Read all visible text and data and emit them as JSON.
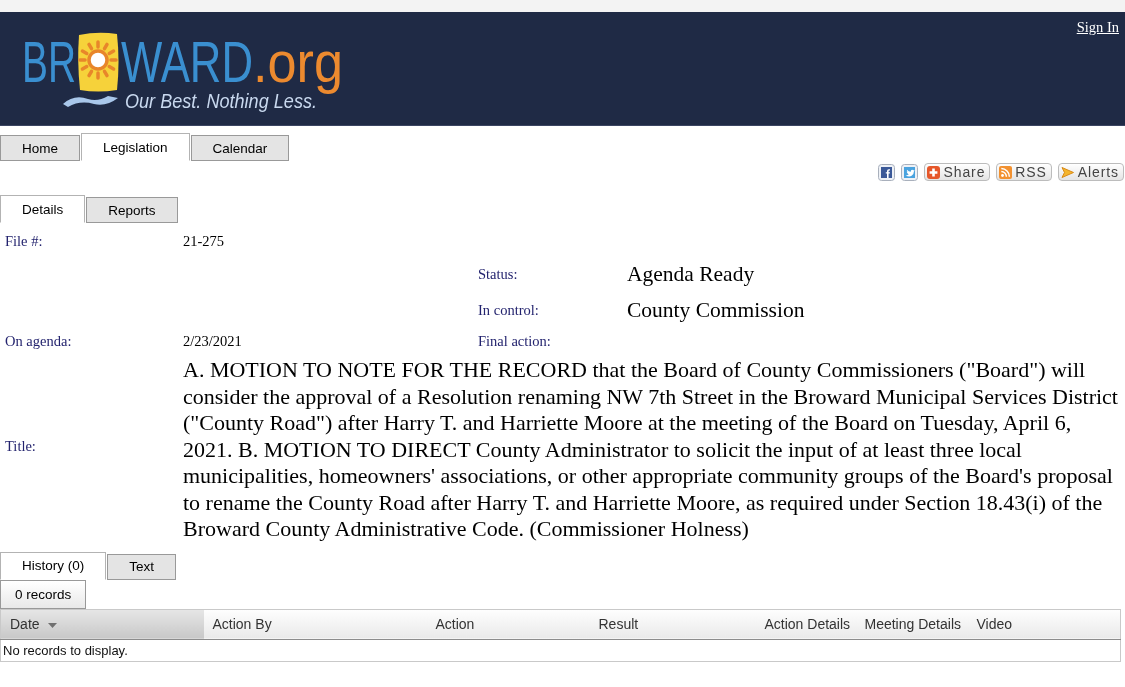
{
  "header": {
    "logo": {
      "wordmark": [
        {
          "text": "BR",
          "kind": "name"
        },
        {
          "text": "WARD",
          "kind": "name"
        },
        {
          "text": ".org",
          "kind": "domain"
        }
      ],
      "tagline": "Our Best. Nothing Less."
    },
    "sign_in": "Sign In"
  },
  "main_tabs": [
    {
      "label": "Home",
      "selected": false
    },
    {
      "label": "Legislation",
      "selected": true
    },
    {
      "label": "Calendar",
      "selected": false
    }
  ],
  "share_bar": [
    {
      "kind": "share",
      "label": "Share"
    },
    {
      "kind": "rss",
      "label": "RSS"
    },
    {
      "kind": "alerts",
      "label": "Alerts"
    }
  ],
  "detail_tabs": [
    {
      "label": "Details",
      "selected": true
    },
    {
      "label": "Reports",
      "selected": false
    }
  ],
  "details": {
    "file_number": {
      "label": "File #:",
      "value": "21-275"
    },
    "status": {
      "label": "Status:",
      "value": "Agenda Ready"
    },
    "in_control": {
      "label": "In control:",
      "value": "County Commission"
    },
    "on_agenda": {
      "label": "On agenda:",
      "value": "2/23/2021"
    },
    "final_action": {
      "label": "Final action:"
    },
    "title": {
      "label": "Title:",
      "value": "A. MOTION TO NOTE FOR THE RECORD that the Board of County Commissioners (\"Board\") will consider the approval of a Resolution renaming NW 7th Street in the Broward Municipal Services District (\"County Road\") after Harry T. and Harriette Moore at the meeting of the Board on Tuesday, April 6, 2021. B. MOTION TO DIRECT County Administrator to solicit the input of at least three local municipalities, homeowners' associations, or other appropriate community groups of the Board's proposal to rename the County Road after Harry T. and Harriette Moore, as required under Section 18.43(i) of the Broward County Administrative Code. (Commissioner Holness)"
    }
  },
  "history_tabs": [
    {
      "label": "History (0)",
      "selected": true
    },
    {
      "label": "Text",
      "selected": false
    }
  ],
  "records_button": "0 records",
  "table": {
    "columns": [
      {
        "label": "Date",
        "sorted": true
      },
      {
        "label": "Action By",
        "sorted": false
      },
      {
        "label": "Action",
        "sorted": false
      },
      {
        "label": "Result",
        "sorted": false
      },
      {
        "label": "Action Details",
        "sorted": false
      },
      {
        "label": "Meeting Details",
        "sorted": false
      },
      {
        "label": "Video",
        "sorted": false
      }
    ],
    "empty_message": "No records to display."
  }
}
